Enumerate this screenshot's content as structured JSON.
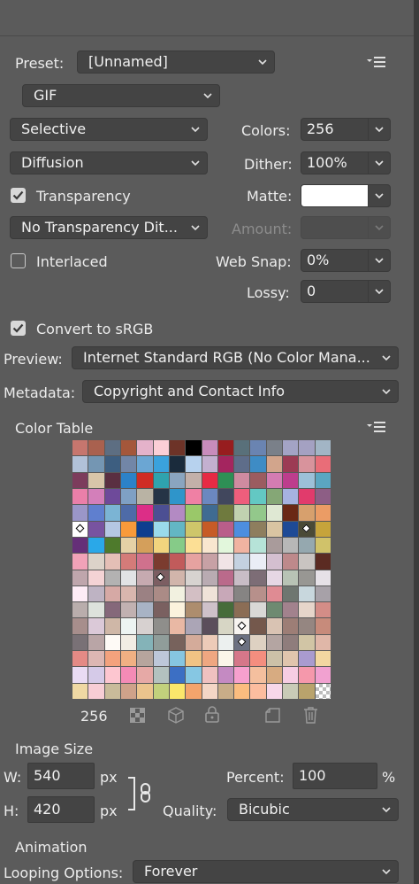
{
  "preset": {
    "label": "Preset:",
    "value": "[Unnamed]"
  },
  "format": {
    "value": "GIF"
  },
  "reduction": {
    "value": "Selective"
  },
  "colors": {
    "label": "Colors:",
    "value": "256"
  },
  "dither_algo": {
    "value": "Diffusion"
  },
  "dither": {
    "label": "Dither:",
    "value": "100%"
  },
  "transparency": {
    "label": "Transparency",
    "checked": true
  },
  "matte": {
    "label": "Matte:",
    "color": "#ffffff"
  },
  "transparency_dither": {
    "value": "No Transparency Dit..."
  },
  "amount": {
    "label": "Amount:"
  },
  "interlaced": {
    "label": "Interlaced",
    "checked": false
  },
  "web_snap": {
    "label": "Web Snap:",
    "value": "0%"
  },
  "lossy": {
    "label": "Lossy:",
    "value": "0"
  },
  "convert_srgb": {
    "label": "Convert to sRGB",
    "checked": true
  },
  "preview": {
    "label": "Preview:",
    "value": "Internet Standard RGB (No Color Mana..."
  },
  "metadata": {
    "label": "Metadata:",
    "value": "Copyright and Contact Info"
  },
  "color_table": {
    "title": "Color Table",
    "count": "256",
    "swatches": [
      "#c6766e",
      "#a9614f",
      "#5d6e82",
      "#a4573b",
      "#e4b2ca",
      "#fbcfd6",
      "#6d3328",
      "#000000",
      "#c88cbc",
      "#971d1f",
      "#59707a",
      "#6a84b1",
      "#7a8089",
      "#a3a3c5",
      "#a4a1c2",
      "#a2b5c5",
      "#b1c1d8",
      "#7496b3",
      "#3d5e80",
      "#7286a7",
      "#6ba6d3",
      "#3aa2dd",
      "#1a2b3c",
      "#b7d2ee",
      "#c3b0d0",
      "#a4255f",
      "#5e6d8a",
      "#3e8cc5",
      "#d2a58c",
      "#9c3b54",
      "#d8939c",
      "#e96d78",
      "#7c3c5c",
      "#d8c5a9",
      "#5a2f41",
      "#2c82c8",
      "#cf2c24",
      "#2fa3ae",
      "#8aa5bf",
      "#c3b0a9",
      "#e62a44",
      "#2e8f55",
      "#cf8ba0",
      "#9b5c60",
      "#d47cb2",
      "#bd3d8d",
      "#9cc0d8",
      "#5ba6c1",
      "#ea7fa9",
      "#d37fba",
      "#6e4a9a",
      "#7fa0c4",
      "#b9b3a4",
      "#253446",
      "#2f95ca",
      "#ef80a4",
      "#6b88c0",
      "#41475d",
      "#ee5e7c",
      "#63c8c3",
      "#85a776",
      "#a6b2e0",
      "#e13b6c",
      "#8d5e85",
      "#9a96c8",
      "#5f7fcf",
      "#7bb4d4",
      "#4e6ba8",
      "#dc2e87",
      "#4c4f93",
      "#b38ac3",
      "#9ac869",
      "#3f6b92",
      "#6f7a3e",
      "#c1d2b0",
      "#93c88b",
      "#dfe8d3",
      "#6a2815",
      "#d7a06d",
      "#eb9c65",
      "#ffffff",
      "#7853a0",
      "#b5c7e3",
      "#f89a3a",
      "#0e3e8f",
      "#9adaeb",
      "#63b6c4",
      "#cec66a",
      "#c65b26",
      "#b95e8a",
      "#4d8edf",
      "#8e7e5e",
      "#d9c4a2",
      "#1e4a96",
      "#4a4a36",
      "#c6a43b",
      "#652f78",
      "#2aa8e8",
      "#4e7a2c",
      "#e5d1a6",
      "#d49f5b",
      "#f1d47e",
      "#86cb88",
      "#fcdf95",
      "#f8e6cf",
      "#e2f7dc",
      "#f0b3a1",
      "#b6e3d8",
      "#a99b9b",
      "#b7b7b7",
      "#95a8af",
      "#d0c26a",
      "#f1a2b8",
      "#dcd3c9",
      "#e4bfb6",
      "#d47b79",
      "#d0718d",
      "#7b3b2f",
      "#c15b5b",
      "#e6a2a0",
      "#c7a1a5",
      "#f1e4e6",
      "#c4d1e0",
      "#eaedf6",
      "#d4bfd0",
      "#be898b",
      "#c9c4c1",
      "#5b2b22",
      "#bfa6ac",
      "#f4d3d5",
      "#b3b2b2",
      "#e1e3e5",
      "#c6aab0",
      "#7c5e62",
      "#d1b5ab",
      "#d7d3d0",
      "#b9abb2",
      "#ba6a8b",
      "#c8bdc6",
      "#7d6d76",
      "#e6d7e4",
      "#b8c3b5",
      "#989793",
      "#e6e1e7",
      "#feecf6",
      "#beb3c3",
      "#d6a9a5",
      "#d8b6ae",
      "#9b8183",
      "#ab8b86",
      "#f2f1e0",
      "#d3bfc4",
      "#efe2d8",
      "#c8a8b8",
      "#868483",
      "#b7908b",
      "#df8b93",
      "#6e7670",
      "#c8d7dd",
      "#a7a1a8",
      "#b9adac",
      "#dde2dc",
      "#85687a",
      "#c1b1b1",
      "#a8b3c5",
      "#7a6060",
      "#fbf2dd",
      "#ad8d6e",
      "#cec1c9",
      "#466c3a",
      "#8b6d55",
      "#d9d8d6",
      "#6e8a71",
      "#a2828d",
      "#e6d5ca",
      "#d48d87",
      "#a78e8c",
      "#dbc9d8",
      "#cfb7a7",
      "#edf4f2",
      "#d7d1d0",
      "#8f8e8b",
      "#e9b8a4",
      "#aba5b6",
      "#5b4e5b",
      "#d7d6c5",
      "#f7f4f0",
      "#74584c",
      "#d9c3b3",
      "#9d7e76",
      "#958681",
      "#c78b7b",
      "#797176",
      "#b9a5a6",
      "#fefaf6",
      "#f2ede4",
      "#84b3b8",
      "#909d9a",
      "#77625c",
      "#d4ab9a",
      "#edcbb8",
      "#ecf0ef",
      "#6c7181",
      "#ded1c2",
      "#b4a5a2",
      "#8f7d7c",
      "#d1c5a5",
      "#e0b7a8",
      "#e48a85",
      "#dcb7b3",
      "#f3a27d",
      "#f0b083",
      "#b6a59d",
      "#bdc7d9",
      "#86c6e1",
      "#f0c384",
      "#efa781",
      "#fbf6e9",
      "#d57789",
      "#f48e7f",
      "#ccc1a8",
      "#e0c5ad",
      "#a99bcf",
      "#f2d7a1",
      "#e9dbf3",
      "#d5cae8",
      "#fdc6d0",
      "#f48bb6",
      "#e6a9a6",
      "#b3c1bf",
      "#3c6fc4",
      "#86c7e3",
      "#f0c1c0",
      "#c48ac2",
      "#f7a0ce",
      "#f4bf9e",
      "#d7ab81",
      "#f6cde3",
      "#f598ab",
      "#f1a1d0",
      "#efd8a3",
      "#f7cdd5",
      "#c9bb9a",
      "#cfa28a",
      "#ebc48d",
      "#c2d17c",
      "#fbe66b",
      "#f3a46c",
      "#f4d6c6",
      "#c8ad88",
      "#fbbd7f",
      "#fcbd9f",
      "#f7d7e9",
      "#c9cbb7",
      "#b9a36c",
      "#ece9e6"
    ],
    "marked": [
      80,
      94,
      133,
      186,
      202
    ]
  },
  "image_size": {
    "title": "Image Size",
    "w_label": "W:",
    "w_value": "540",
    "h_label": "H:",
    "h_value": "420",
    "px1": "px",
    "px2": "px",
    "percent_label": "Percent:",
    "percent_value": "100",
    "percent_unit": "%",
    "quality_label": "Quality:",
    "quality_value": "Bicubic"
  },
  "animation": {
    "title": "Animation",
    "looping_label": "Looping Options:",
    "looping_value": "Forever"
  }
}
